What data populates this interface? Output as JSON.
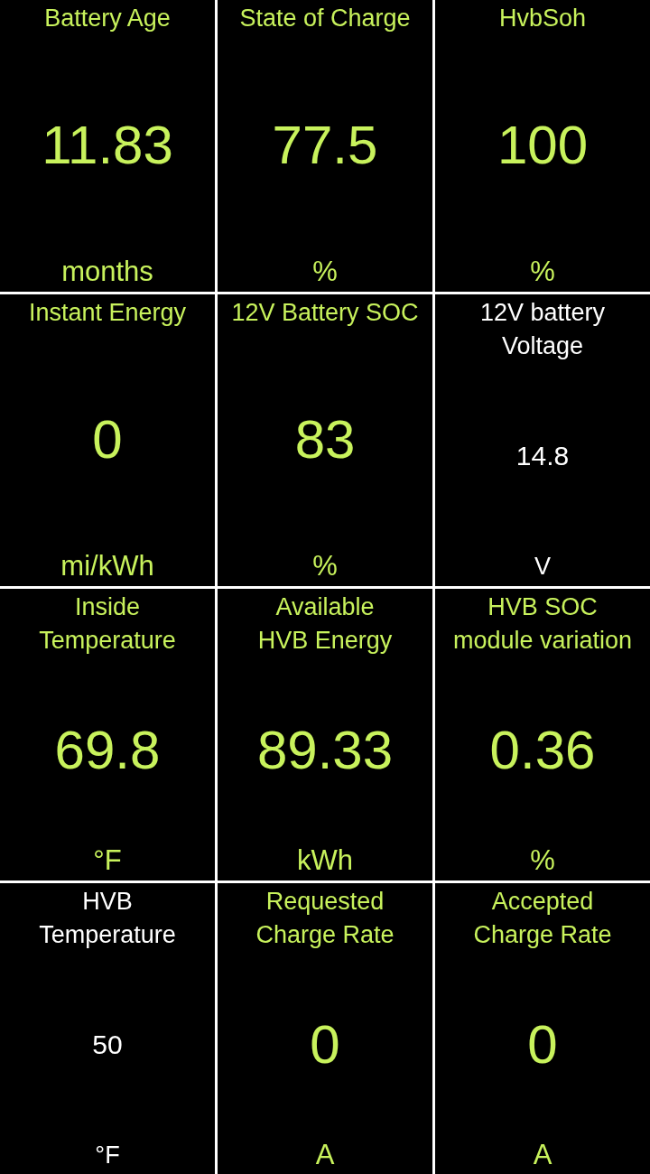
{
  "tiles": [
    {
      "title_lines": [
        "Battery Age"
      ],
      "value": "11.83",
      "unit": "months",
      "color": "#c8f25c",
      "kind": "big"
    },
    {
      "title_lines": [
        "State of Charge"
      ],
      "value": "77.5",
      "unit": "%",
      "color": "#c8f25c",
      "kind": "big"
    },
    {
      "title_lines": [
        "HvbSoh"
      ],
      "value": "100",
      "unit": "%",
      "color": "#c8f25c",
      "kind": "big"
    },
    {
      "title_lines": [
        "Instant Energy"
      ],
      "value": "0",
      "unit": "mi/kWh",
      "color": "#c8f25c",
      "kind": "big"
    },
    {
      "title_lines": [
        "12V Battery SOC"
      ],
      "value": "83",
      "unit": "%",
      "color": "#c8f25c",
      "kind": "big"
    },
    {
      "title_lines": [
        "12V battery",
        "Voltage"
      ],
      "value": "14.8",
      "unit": "V",
      "color": "#ffffff",
      "kind": "small"
    },
    {
      "title_lines": [
        "Inside",
        "Temperature"
      ],
      "value": "69.8",
      "unit": "°F",
      "color": "#c8f25c",
      "kind": "big"
    },
    {
      "title_lines": [
        "Available",
        "HVB Energy"
      ],
      "value": "89.33",
      "unit": "kWh",
      "color": "#c8f25c",
      "kind": "big"
    },
    {
      "title_lines": [
        "HVB SOC",
        "module variation"
      ],
      "value": "0.36",
      "unit": "%",
      "color": "#c8f25c",
      "kind": "big"
    },
    {
      "title_lines": [
        "HVB",
        "Temperature"
      ],
      "value": "50",
      "unit": "°F",
      "color": "#ffffff",
      "kind": "small"
    },
    {
      "title_lines": [
        "Requested",
        "Charge Rate"
      ],
      "value": "0",
      "unit": "A",
      "color": "#c8f25c",
      "kind": "big"
    },
    {
      "title_lines": [
        "Accepted",
        "Charge Rate"
      ],
      "value": "0",
      "unit": "A",
      "color": "#c8f25c",
      "kind": "big"
    }
  ]
}
